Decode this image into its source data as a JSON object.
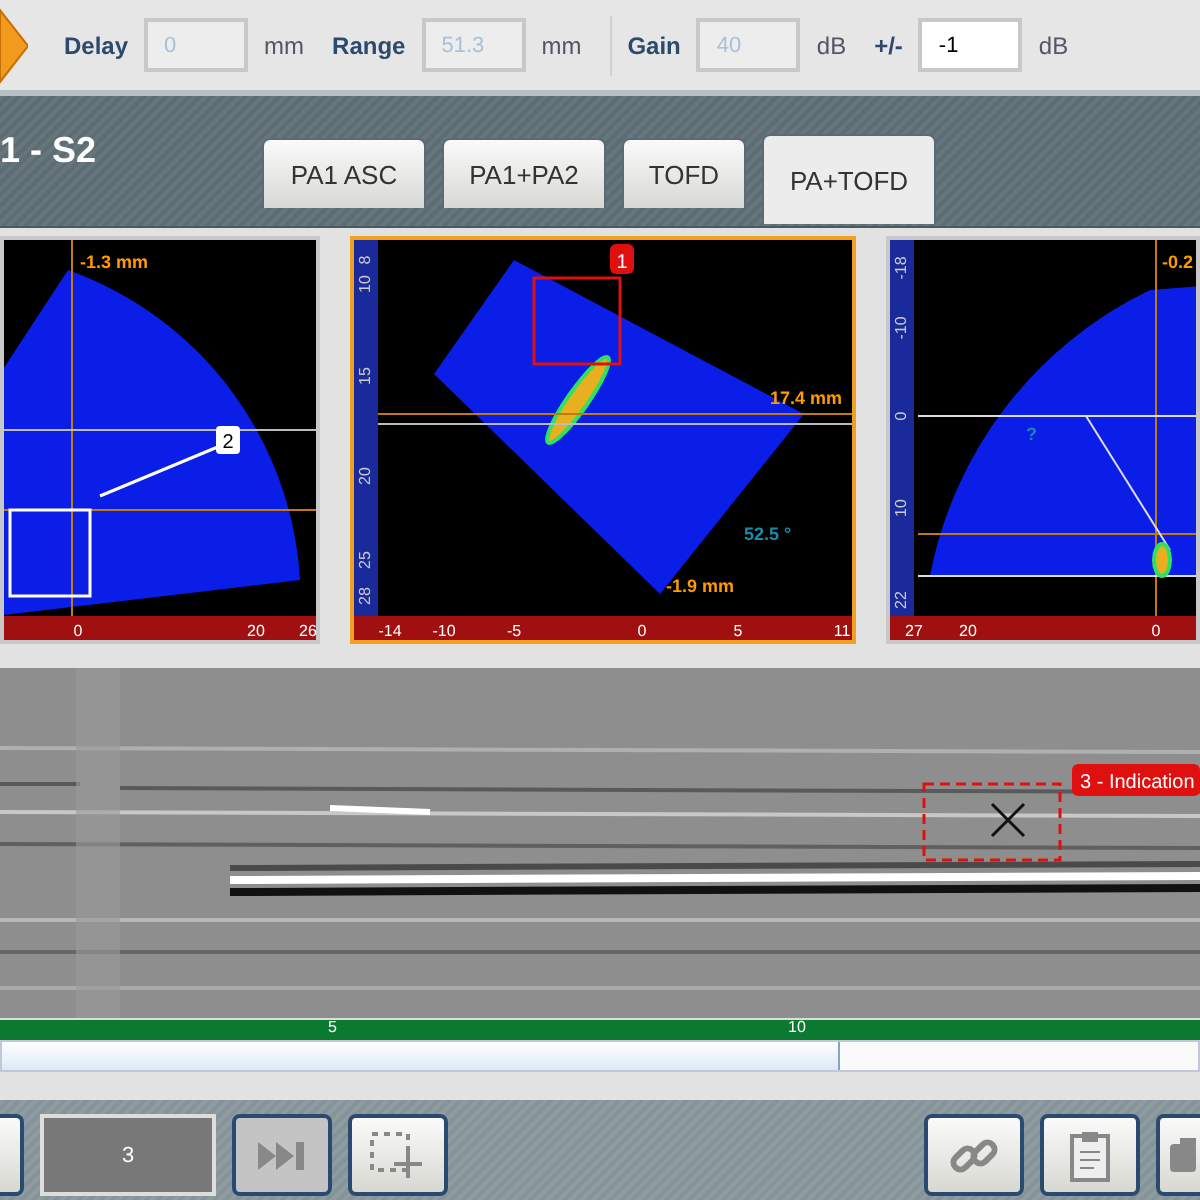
{
  "toolbar": {
    "fields": [
      {
        "label": "Delay",
        "value": "0",
        "unit": "mm",
        "disabled": true
      },
      {
        "label": "Range",
        "value": "51.3",
        "unit": "mm",
        "disabled": true
      },
      {
        "label": "Gain",
        "value": "40",
        "unit": "dB",
        "disabled": true
      },
      {
        "label": "+/-",
        "value": "-1",
        "unit": "dB",
        "disabled": false
      }
    ]
  },
  "view": {
    "title": "1 - S2",
    "tabs": [
      {
        "label": "PA1 ASC",
        "selected": false
      },
      {
        "label": "PA1+PA2",
        "selected": false
      },
      {
        "label": "TOFD",
        "selected": false
      },
      {
        "label": "PA+TOFD",
        "selected": true
      }
    ]
  },
  "scans": [
    {
      "kind": "sector",
      "selected": false,
      "index_ticks": [
        "0",
        "20",
        "26"
      ],
      "readouts": [
        "-1.3 mm"
      ],
      "marker": "2"
    },
    {
      "kind": "linear",
      "selected": true,
      "depth_ticks": [
        "8",
        "10",
        "15",
        "20",
        "25",
        "28"
      ],
      "index_ticks": [
        "-14",
        "-10",
        "-5",
        "0",
        "5",
        "11"
      ],
      "readouts": [
        "17.4 mm",
        "52.5 °",
        "-1.9 mm"
      ],
      "marker": "1"
    },
    {
      "kind": "sector_right",
      "selected": false,
      "depth_ticks": [
        "-18",
        "-10",
        "0",
        "10",
        "22"
      ],
      "index_ticks": [
        "27",
        "20",
        "0"
      ],
      "readouts": [
        "-0.2",
        "?"
      ]
    }
  ],
  "tofd": {
    "indication": "3 - Indication",
    "scale_ticks": [
      "5",
      "10"
    ],
    "scroll": {
      "level": 0.7
    }
  },
  "bottom_bar": {
    "frame_value": "3"
  }
}
